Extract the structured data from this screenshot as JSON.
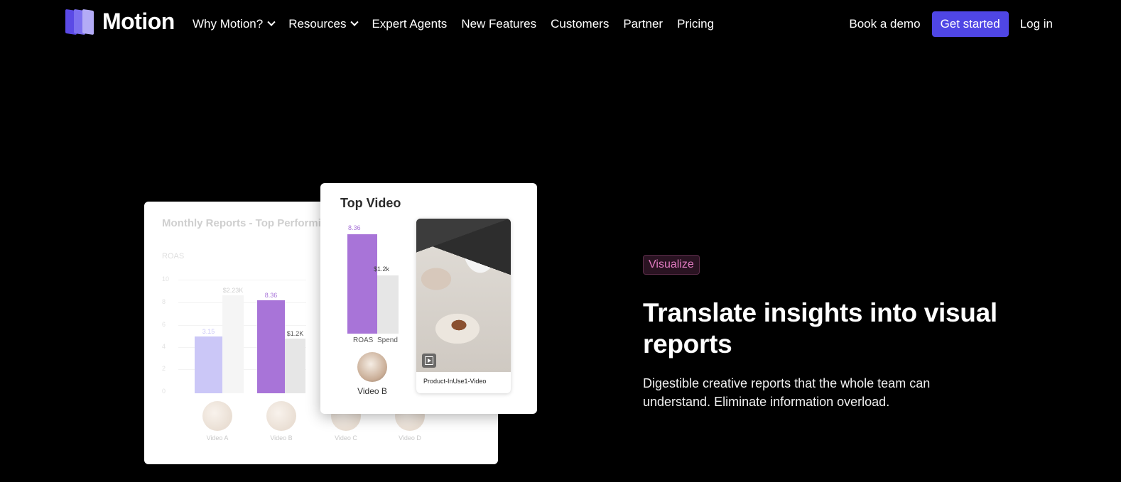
{
  "brand": {
    "name": "Motion",
    "logo_colors": [
      "#5b4ae6",
      "#7d70f0",
      "#b3abf6"
    ]
  },
  "nav": {
    "items": [
      {
        "label": "Why Motion?",
        "dropdown": true
      },
      {
        "label": "Resources",
        "dropdown": true
      },
      {
        "label": "Expert Agents",
        "dropdown": false
      },
      {
        "label": "New Features",
        "dropdown": false
      },
      {
        "label": "Customers",
        "dropdown": false
      },
      {
        "label": "Partner",
        "dropdown": false
      },
      {
        "label": "Pricing",
        "dropdown": false
      }
    ],
    "book_demo": "Book a demo",
    "get_started": "Get started",
    "login": "Log in",
    "accent": "#4f46e5"
  },
  "illustration": {
    "back_card": {
      "title": "Monthly Reports - Top Performi",
      "axis_label": "ROAS",
      "y_ticks": [
        "10",
        "8",
        "6",
        "4",
        "2",
        "0"
      ],
      "bars": [
        {
          "value_label": "3.15",
          "value": 5.0,
          "color": "#cbc7f7",
          "label_color": "#cbc7f7"
        },
        {
          "value_label": "$2.23K",
          "value": 8.6,
          "color": "#f5f5f5",
          "label_color": "#cfcfcf"
        },
        {
          "value_label": "8.36",
          "value": 8.2,
          "color": "#a874d8",
          "label_color": "#a874d8"
        },
        {
          "value_label": "$1.2K",
          "value": 4.8,
          "color": "#e6e6e6",
          "label_color": "#555555"
        }
      ],
      "thumbs": [
        "Video A",
        "Video B",
        "Video C",
        "Video D"
      ]
    },
    "front_card": {
      "title": "Top Video",
      "roas_value": "8.36",
      "spend_value": "$1.2k",
      "roas_label": "ROAS",
      "spend_label": "Spend",
      "video_name": "Video B",
      "video_caption": "Product-InUse1-Video"
    }
  },
  "hero": {
    "badge": "Visualize",
    "headline": "Translate insights into visual reports",
    "subtext": "Digestible creative reports that the whole team can understand. Eliminate information overload.",
    "badge_color": "#e07ac0"
  }
}
